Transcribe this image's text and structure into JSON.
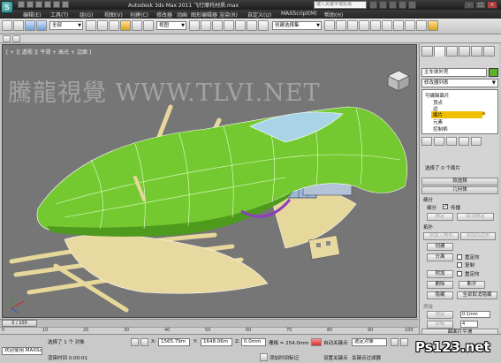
{
  "title_bar": {
    "title": "Autodesk 3ds Max  2011     飞行摩托材质.max",
    "search_placeholder": "键入关键字或短语"
  },
  "menu": {
    "items": [
      "编辑(E)",
      "工具(T)",
      "组(G)",
      "视图(V)",
      "创建(C)",
      "修改器",
      "动画",
      "图形编辑器",
      "渲染(R)",
      "自定义(U)",
      "MAXScript(M)",
      "帮助(H)"
    ]
  },
  "toolbar": {
    "selection_filter": "全部",
    "reference_coord": "视图",
    "named_selection": "创建选择集"
  },
  "viewport": {
    "label": "[ + ][ 透视 ][ 平滑 + 高光 + 边面 ]",
    "watermark": "騰龍視覺 WWW.TLVI.NET"
  },
  "command_panel": {
    "object_name": "主车体外壳",
    "modifier_list": "修改器列表",
    "stack": {
      "items": [
        "可编辑面片",
        "顶点",
        "边",
        "面片",
        "元素",
        "控制柄"
      ]
    },
    "selected_status": "选择了 0 个面片",
    "rollouts": {
      "soft_selection": "软选择",
      "geometry": "几何体"
    },
    "subdivision": {
      "label": "细分",
      "subdivide_btn": "细分",
      "propagate_label": "传播",
      "bind_btn": "绑定",
      "unbind_btn": "取消绑定"
    },
    "topology": {
      "label": "拓扑",
      "add_tri": "添加三角形",
      "add_quad": "添加四边形",
      "create": "创建",
      "detach": "分离",
      "reorient": "重定向",
      "copy": "复制",
      "attach": "附加",
      "reorient2": "重定向",
      "delete": "删除",
      "break": "断开",
      "hide": "隐藏",
      "unhide_all": "全部取消隐藏"
    },
    "weld": {
      "label": "焊接",
      "selected": "选定",
      "selected_value": "0.1mm",
      "target": "目标",
      "target_value": "4"
    },
    "bottom_rollout": "曲面片平滑"
  },
  "timeline": {
    "frame": "0 / 100",
    "ticks": [
      "0",
      "10",
      "20",
      "30",
      "40",
      "50",
      "60",
      "70",
      "80",
      "90",
      "100"
    ]
  },
  "status": {
    "welcome": "欢迎使用 MAXSc",
    "selected": "选择了 1 个 对象",
    "render_time": "渲染时间 0:00:01",
    "x_value": "1565.79m",
    "y_value": "1648.06m",
    "z_value": "0.0mm",
    "grid": "栅格 = 254.0mm",
    "add_time_tag": "添加时间标记",
    "auto_key": "自动关键点",
    "set_key": "设置关键点",
    "selected_obj": "选定对象",
    "key_filters": "关键点过滤器"
  },
  "brand_mark": "Ps123.net"
}
